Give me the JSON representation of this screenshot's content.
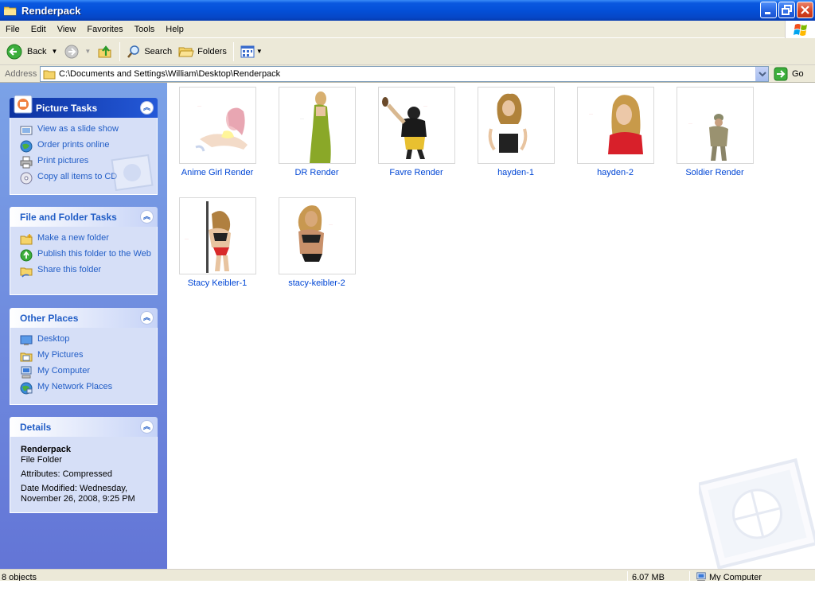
{
  "window": {
    "title": "Renderpack"
  },
  "menu": [
    "File",
    "Edit",
    "View",
    "Favorites",
    "Tools",
    "Help"
  ],
  "toolbar": {
    "back": "Back",
    "search": "Search",
    "folders": "Folders"
  },
  "address": {
    "label": "Address",
    "path": "C:\\Documents and Settings\\William\\Desktop\\Renderpack",
    "go": "Go"
  },
  "panels": {
    "picture_tasks": {
      "title": "Picture Tasks",
      "items": [
        "View as a slide show",
        "Order prints online",
        "Print pictures",
        "Copy all items to CD"
      ]
    },
    "file_folder_tasks": {
      "title": "File and Folder Tasks",
      "items": [
        "Make a new folder",
        "Publish this folder to the Web",
        "Share this folder"
      ]
    },
    "other_places": {
      "title": "Other Places",
      "items": [
        "Desktop",
        "My Pictures",
        "My Computer",
        "My Network Places"
      ]
    },
    "details": {
      "title": "Details",
      "name": "Renderpack",
      "type": "File Folder",
      "attributes": "Attributes: Compressed",
      "modified": "Date Modified: Wednesday, November 26, 2008, 9:25 PM"
    }
  },
  "files": [
    {
      "name": "Anime Girl Render",
      "icon": "anime-girl-thumbnail"
    },
    {
      "name": "DR Render",
      "icon": "dr-render-thumbnail"
    },
    {
      "name": "Favre Render",
      "icon": "favre-render-thumbnail"
    },
    {
      "name": "hayden-1",
      "icon": "hayden-1-thumbnail"
    },
    {
      "name": "hayden-2",
      "icon": "hayden-2-thumbnail"
    },
    {
      "name": "Soldier Render",
      "icon": "soldier-render-thumbnail"
    },
    {
      "name": "Stacy Keibler-1",
      "icon": "stacy-keibler-1-thumbnail"
    },
    {
      "name": "stacy-keibler-2",
      "icon": "stacy-keibler-2-thumbnail"
    }
  ],
  "status": {
    "objects": "8 objects",
    "size": "6.07 MB",
    "location": "My Computer"
  },
  "colors": {
    "titlebar": "#0450d8",
    "link": "#215dc6",
    "pane": "#7ba2e7"
  }
}
